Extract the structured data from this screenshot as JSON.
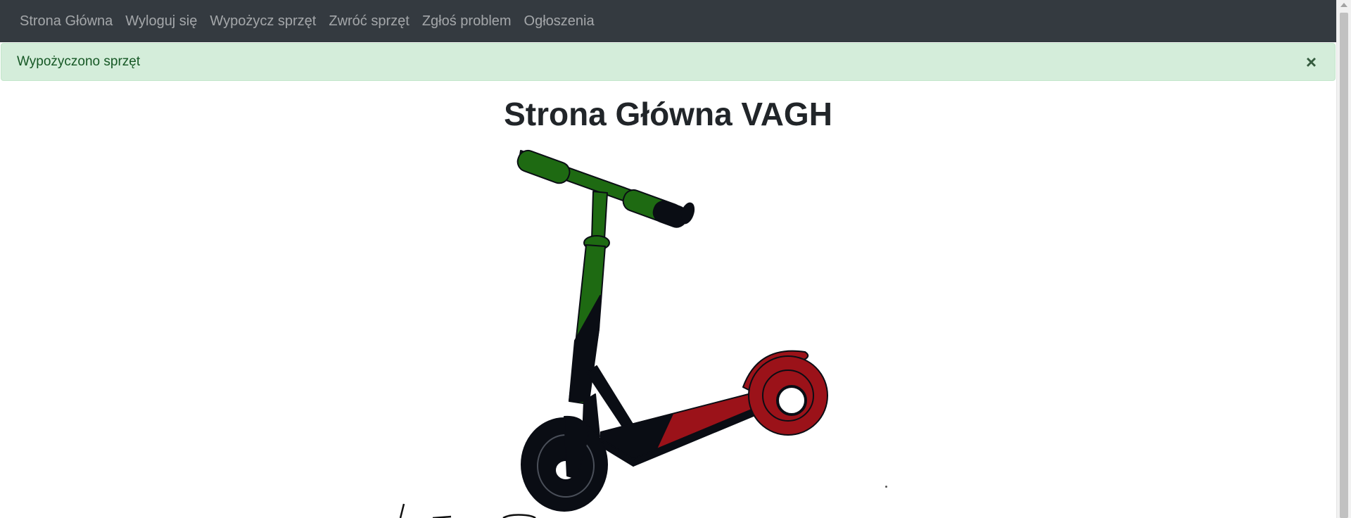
{
  "nav": {
    "items": [
      {
        "label": "Strona Główna"
      },
      {
        "label": "Wyloguj się"
      },
      {
        "label": "Wypożycz sprzęt"
      },
      {
        "label": "Zwróć sprzęt"
      },
      {
        "label": "Zgłoś problem"
      },
      {
        "label": "Ogłoszenia"
      }
    ]
  },
  "alert": {
    "message": "Wypożyczono sprzęt",
    "close_symbol": "×"
  },
  "page": {
    "title": "Strona Główna VAGH"
  },
  "colors": {
    "navbar_bg": "#343a40",
    "alert_bg": "#d4edda",
    "alert_text": "#155724",
    "scooter_green": "#1e6a12",
    "scooter_red": "#9b1219",
    "scooter_black": "#0a0d14"
  },
  "icons": {
    "illustration": "scooter-illustration",
    "close": "close-icon"
  }
}
